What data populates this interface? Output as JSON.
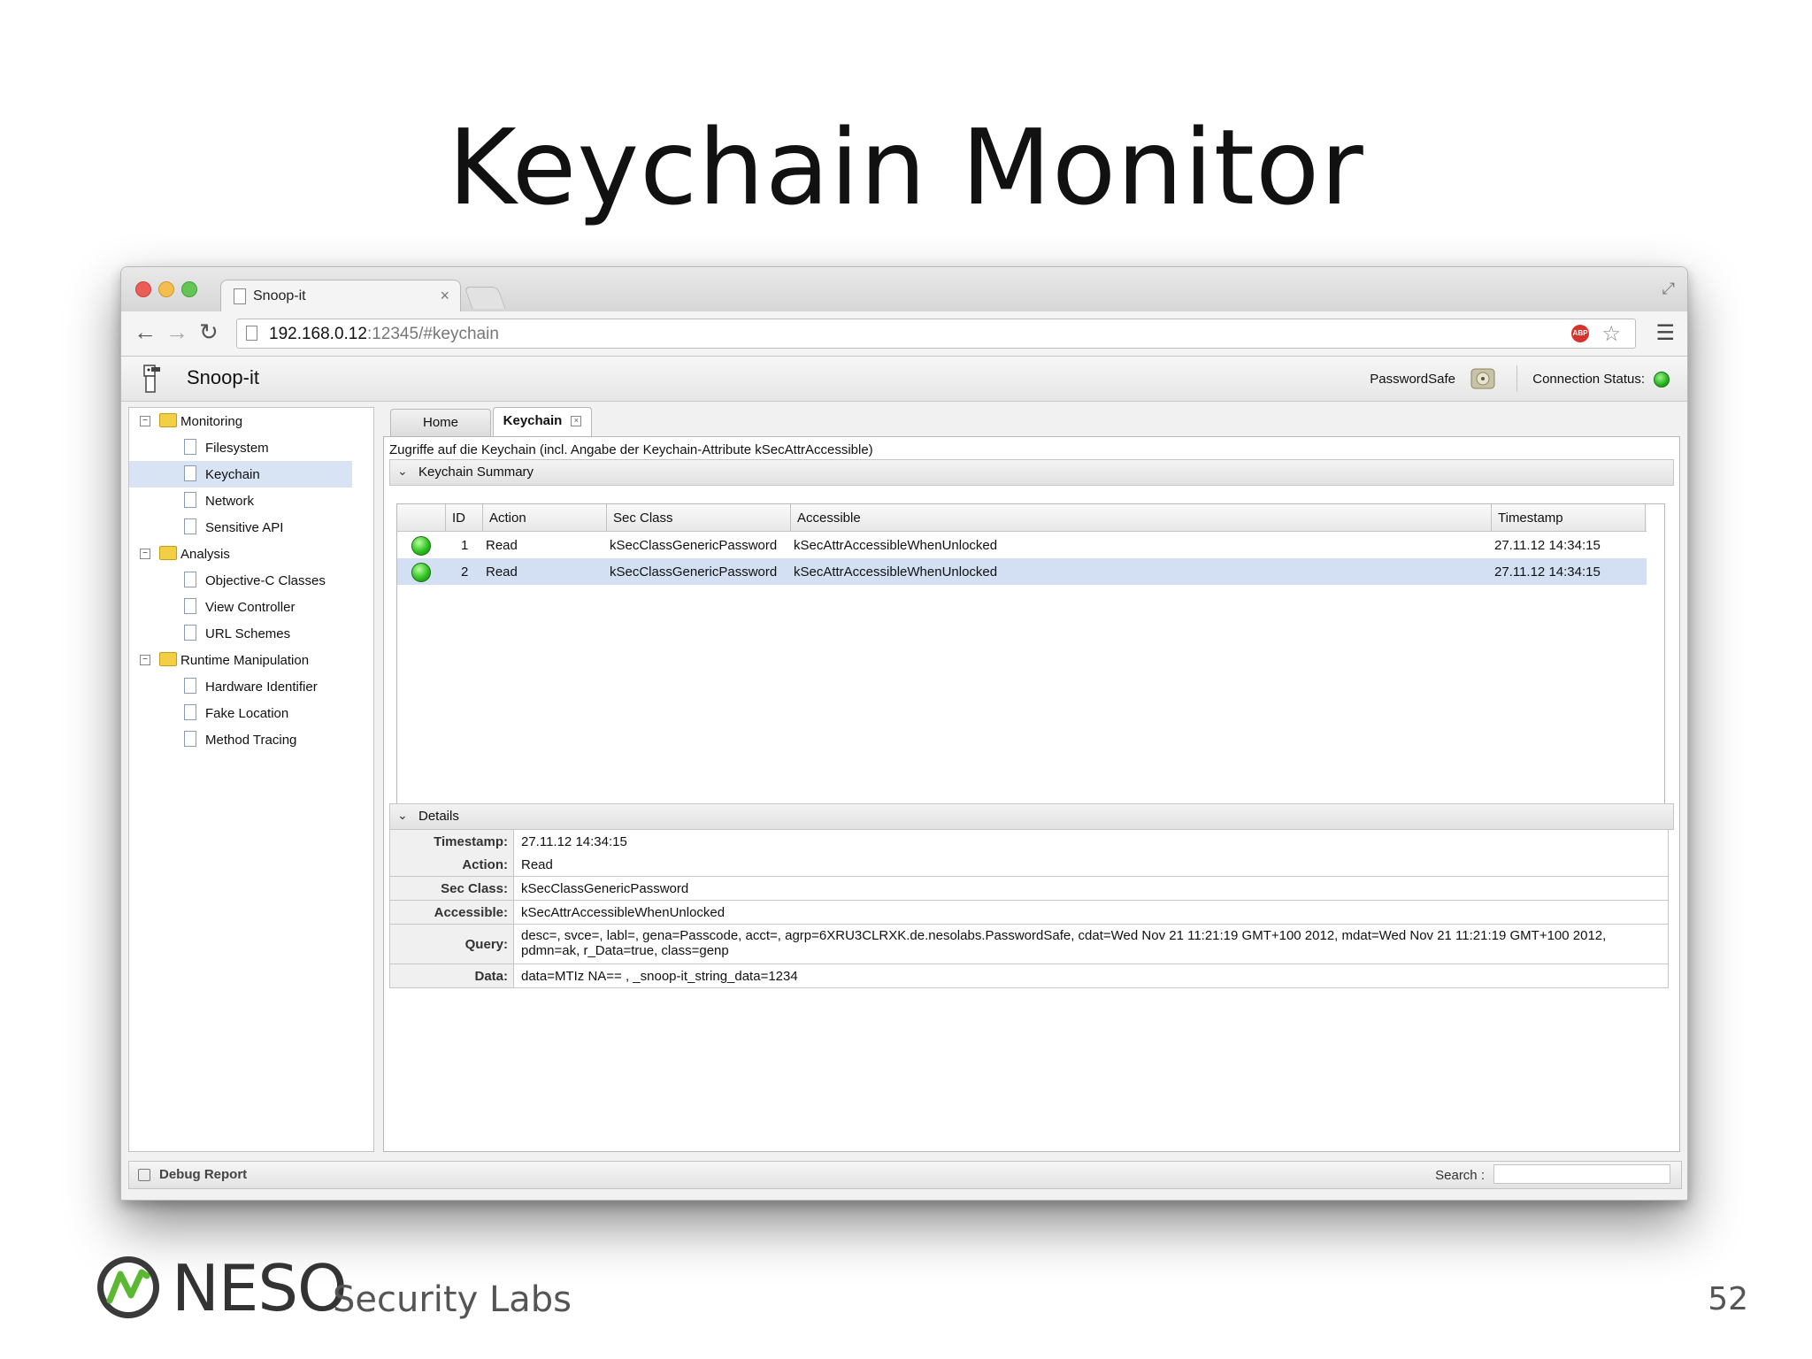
{
  "slide": {
    "title": "Keychain Monitor",
    "page_number": "52"
  },
  "browser": {
    "tab_title": "Snoop-it",
    "url_host": "192.168.0.12",
    "url_rest": ":12345/#keychain"
  },
  "app": {
    "title": "Snoop-it",
    "target_app": "PasswordSafe",
    "connection_label": "Connection Status:",
    "connection_color": "#23b01c"
  },
  "sidebar": {
    "groups": [
      {
        "label": "Monitoring",
        "items": [
          "Filesystem",
          "Keychain",
          "Network",
          "Sensitive API"
        ]
      },
      {
        "label": "Analysis",
        "items": [
          "Objective-C Classes",
          "View Controller",
          "URL Schemes"
        ]
      },
      {
        "label": "Runtime Manipulation",
        "items": [
          "Hardware Identifier",
          "Fake Location",
          "Method Tracing"
        ]
      }
    ],
    "selected": "Keychain"
  },
  "tabs": {
    "home": "Home",
    "keychain": "Keychain"
  },
  "main": {
    "description": "Zugriffe auf die Keychain (incl. Angabe der Keychain-Attribute kSecAttrAccessible)",
    "summary_title": "Keychain Summary",
    "details_title": "Details"
  },
  "table": {
    "headers": [
      "ID",
      "Action",
      "Sec Class",
      "Accessible",
      "Timestamp"
    ],
    "rows": [
      {
        "id": "1",
        "action": "Read",
        "sec_class": "kSecClassGenericPassword",
        "accessible": "kSecAttrAccessibleWhenUnlocked",
        "timestamp": "27.11.12 14:34:15"
      },
      {
        "id": "2",
        "action": "Read",
        "sec_class": "kSecClassGenericPassword",
        "accessible": "kSecAttrAccessibleWhenUnlocked",
        "timestamp": "27.11.12 14:34:15"
      }
    ]
  },
  "details": {
    "timestamp": {
      "label": "Timestamp:",
      "value": "27.11.12 14:34:15"
    },
    "action": {
      "label": "Action:",
      "value": "Read"
    },
    "sec_class": {
      "label": "Sec Class:",
      "value": "kSecClassGenericPassword"
    },
    "accessible": {
      "label": "Accessible:",
      "value": "kSecAttrAccessibleWhenUnlocked"
    },
    "query": {
      "label": "Query:",
      "value": "desc=, svce=, labl=, gena=Passcode, acct=, agrp=6XRU3CLRXK.de.nesolabs.PasswordSafe, cdat=Wed Nov 21 11:21:19 GMT+100 2012, mdat=Wed Nov 21 11:21:19 GMT+100 2012, pdmn=ak, r_Data=true, class=genp"
    },
    "data": {
      "label": "Data:",
      "value": "data=MTIz NA== , _snoop-it_string_data=1234"
    }
  },
  "statusbar": {
    "debug_label": "Debug Report",
    "search_label": "Search :",
    "search_value": ""
  },
  "footer": {
    "brand": "NESO",
    "brand_sub": "Security Labs"
  }
}
